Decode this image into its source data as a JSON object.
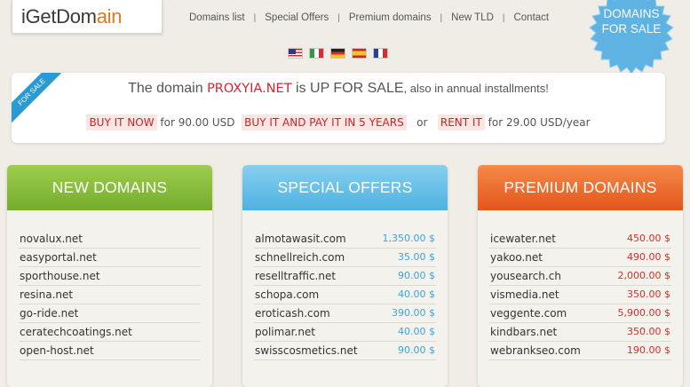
{
  "header": {
    "logo_part1": "iGetDom",
    "logo_part2": "ain",
    "nav": [
      "Domains list",
      "Special Offers",
      "Premium domains",
      "New TLD",
      "Contact"
    ],
    "badge_line1": "DOMAINS",
    "badge_line2": "FOR SALE"
  },
  "flags": [
    "us-flag",
    "it-flag",
    "de-flag",
    "es-flag",
    "fr-flag"
  ],
  "sale": {
    "ribbon": "FOR SALE",
    "prefix": "The domain ",
    "domain": "PROXYIA.NET",
    "middle": " is UP FOR SALE",
    "suffix": ", also in annual installments!",
    "buy_now": "BUY IT NOW",
    "buy_now_price": "for 90.00 USD",
    "installments": "BUY IT AND PAY IT IN 5 YEARS",
    "or": "or",
    "rent": "RENT IT",
    "rent_price": "for 29.00 USD/year"
  },
  "columns": [
    {
      "title": "NEW DOMAINS",
      "rows": [
        {
          "name": "novalux.net",
          "price": ""
        },
        {
          "name": "easyportal.net",
          "price": ""
        },
        {
          "name": "sporthouse.net",
          "price": ""
        },
        {
          "name": "resina.net",
          "price": ""
        },
        {
          "name": "go-ride.net",
          "price": ""
        },
        {
          "name": "ceratechcoatings.net",
          "price": ""
        },
        {
          "name": "open-host.net",
          "price": ""
        }
      ]
    },
    {
      "title": "SPECIAL OFFERS",
      "rows": [
        {
          "name": "almotawasit.com",
          "price": "1,350.00 $"
        },
        {
          "name": "schnellreich.com",
          "price": "35.00 $"
        },
        {
          "name": "reselltraffic.net",
          "price": "90.00 $"
        },
        {
          "name": "schopa.com",
          "price": "40.00 $"
        },
        {
          "name": "eroticash.com",
          "price": "390.00 $"
        },
        {
          "name": "polimar.net",
          "price": "40.00 $"
        },
        {
          "name": "swisscosmetics.net",
          "price": "90.00 $"
        }
      ]
    },
    {
      "title": "PREMIUM DOMAINS",
      "rows": [
        {
          "name": "icewater.net",
          "price": "450.00 $"
        },
        {
          "name": "yakoo.net",
          "price": "490.00 $"
        },
        {
          "name": "yousearch.ch",
          "price": "2,000.00 $"
        },
        {
          "name": "vismedia.net",
          "price": "350.00 $"
        },
        {
          "name": "veggente.com",
          "price": "5,900.00 $"
        },
        {
          "name": "kindbars.net",
          "price": "350.00 $"
        },
        {
          "name": "webrankseo.com",
          "price": "190.00 $"
        }
      ]
    }
  ]
}
